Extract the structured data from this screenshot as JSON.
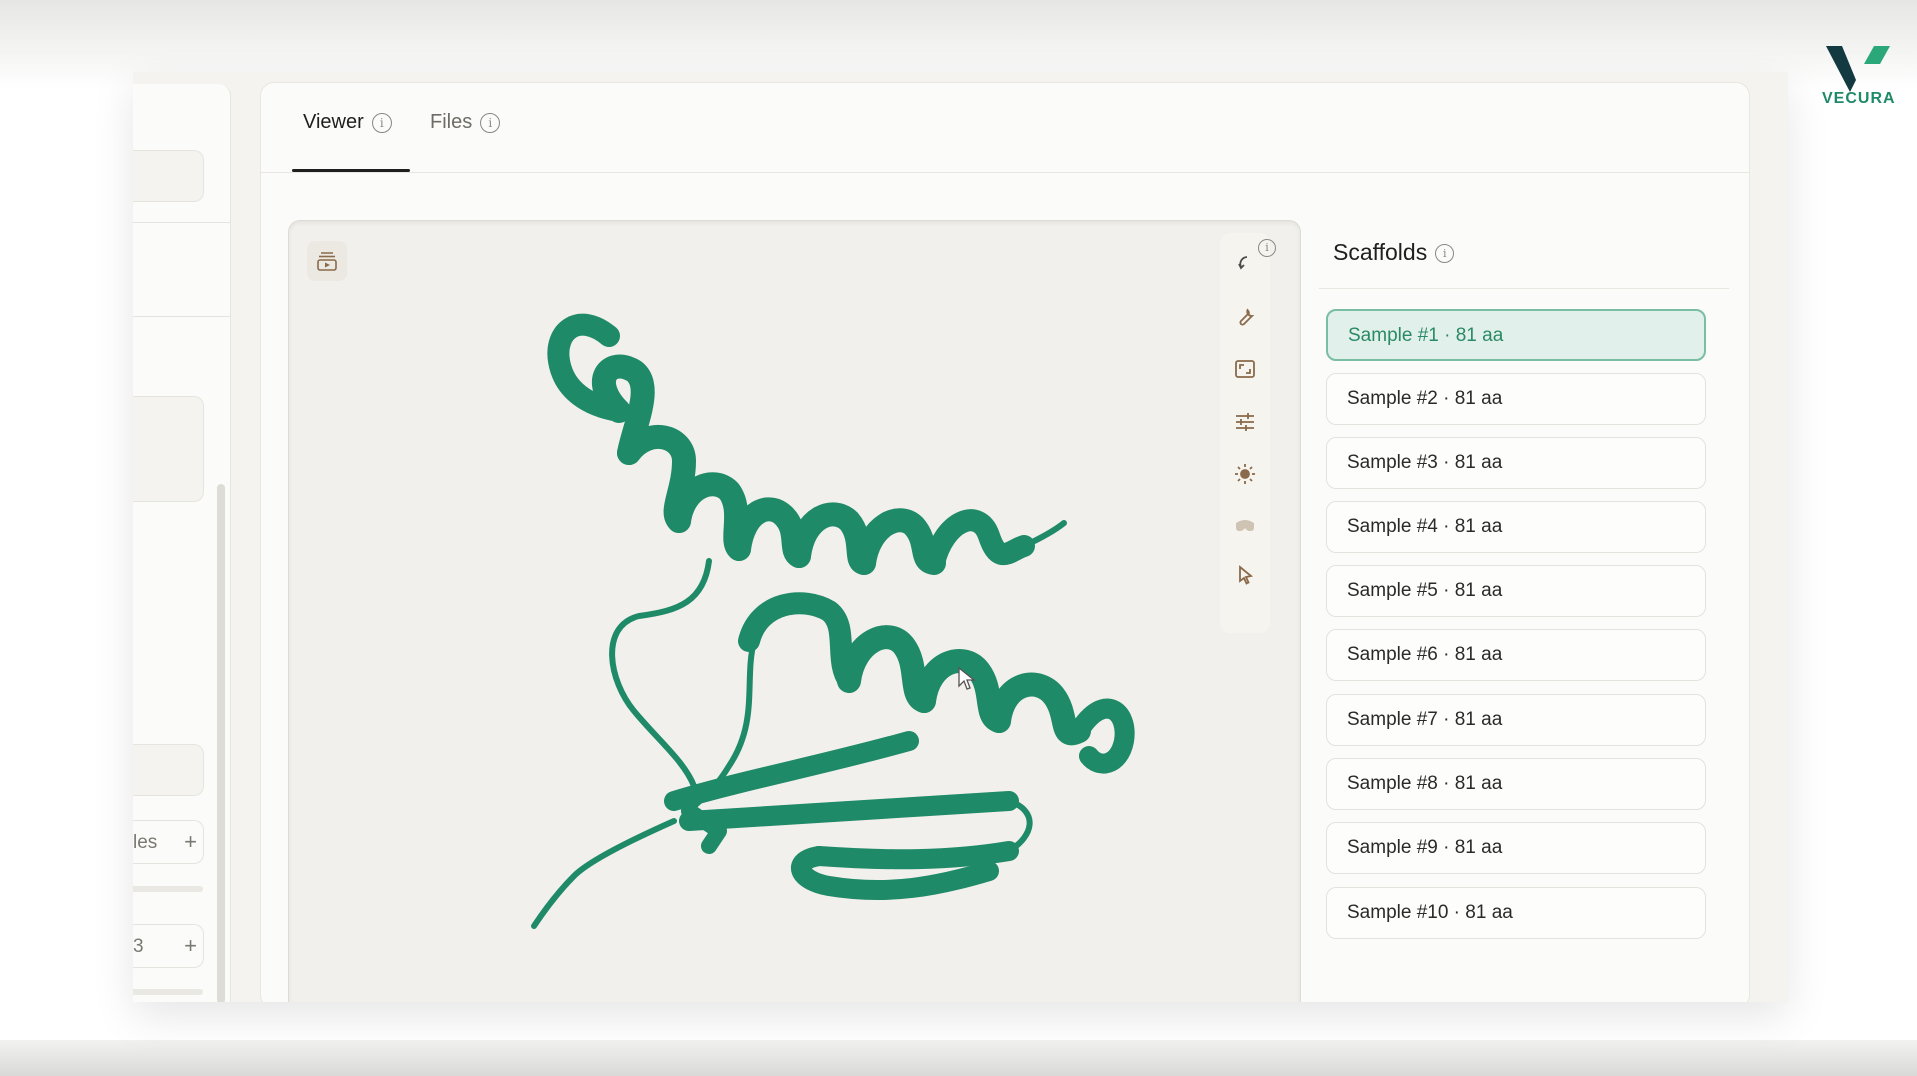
{
  "logo": {
    "text": "VECURA",
    "colors": {
      "dark": "#123a40",
      "green": "#2aa87a"
    }
  },
  "sidebar": {
    "partial_row_1": "les",
    "partial_row_2": "3",
    "plus_symbol": "+"
  },
  "tabs": [
    {
      "label": "Viewer",
      "active": true
    },
    {
      "label": "Files",
      "active": false
    }
  ],
  "viewer": {
    "toolbar_icons": [
      "rotate-icon",
      "wrench-icon",
      "fullscreen-icon",
      "sliders-icon",
      "sun-icon",
      "vr-goggles-icon",
      "pointer-icon"
    ],
    "left_icon": "play-layers-icon",
    "structure_color": "#1f8a68"
  },
  "scaffolds": {
    "title": "Scaffolds",
    "items": [
      {
        "label": "Sample #1 · 81 aa",
        "selected": true
      },
      {
        "label": "Sample #2 · 81 aa",
        "selected": false
      },
      {
        "label": "Sample #3 · 81 aa",
        "selected": false
      },
      {
        "label": "Sample #4 · 81 aa",
        "selected": false
      },
      {
        "label": "Sample #5 · 81 aa",
        "selected": false
      },
      {
        "label": "Sample #6 · 81 aa",
        "selected": false
      },
      {
        "label": "Sample #7 · 81 aa",
        "selected": false
      },
      {
        "label": "Sample #8 · 81 aa",
        "selected": false
      },
      {
        "label": "Sample #9 · 81 aa",
        "selected": false
      },
      {
        "label": "Sample #10 · 81 aa",
        "selected": false
      }
    ]
  },
  "accent": "#2a8a68",
  "info_glyph": "i"
}
